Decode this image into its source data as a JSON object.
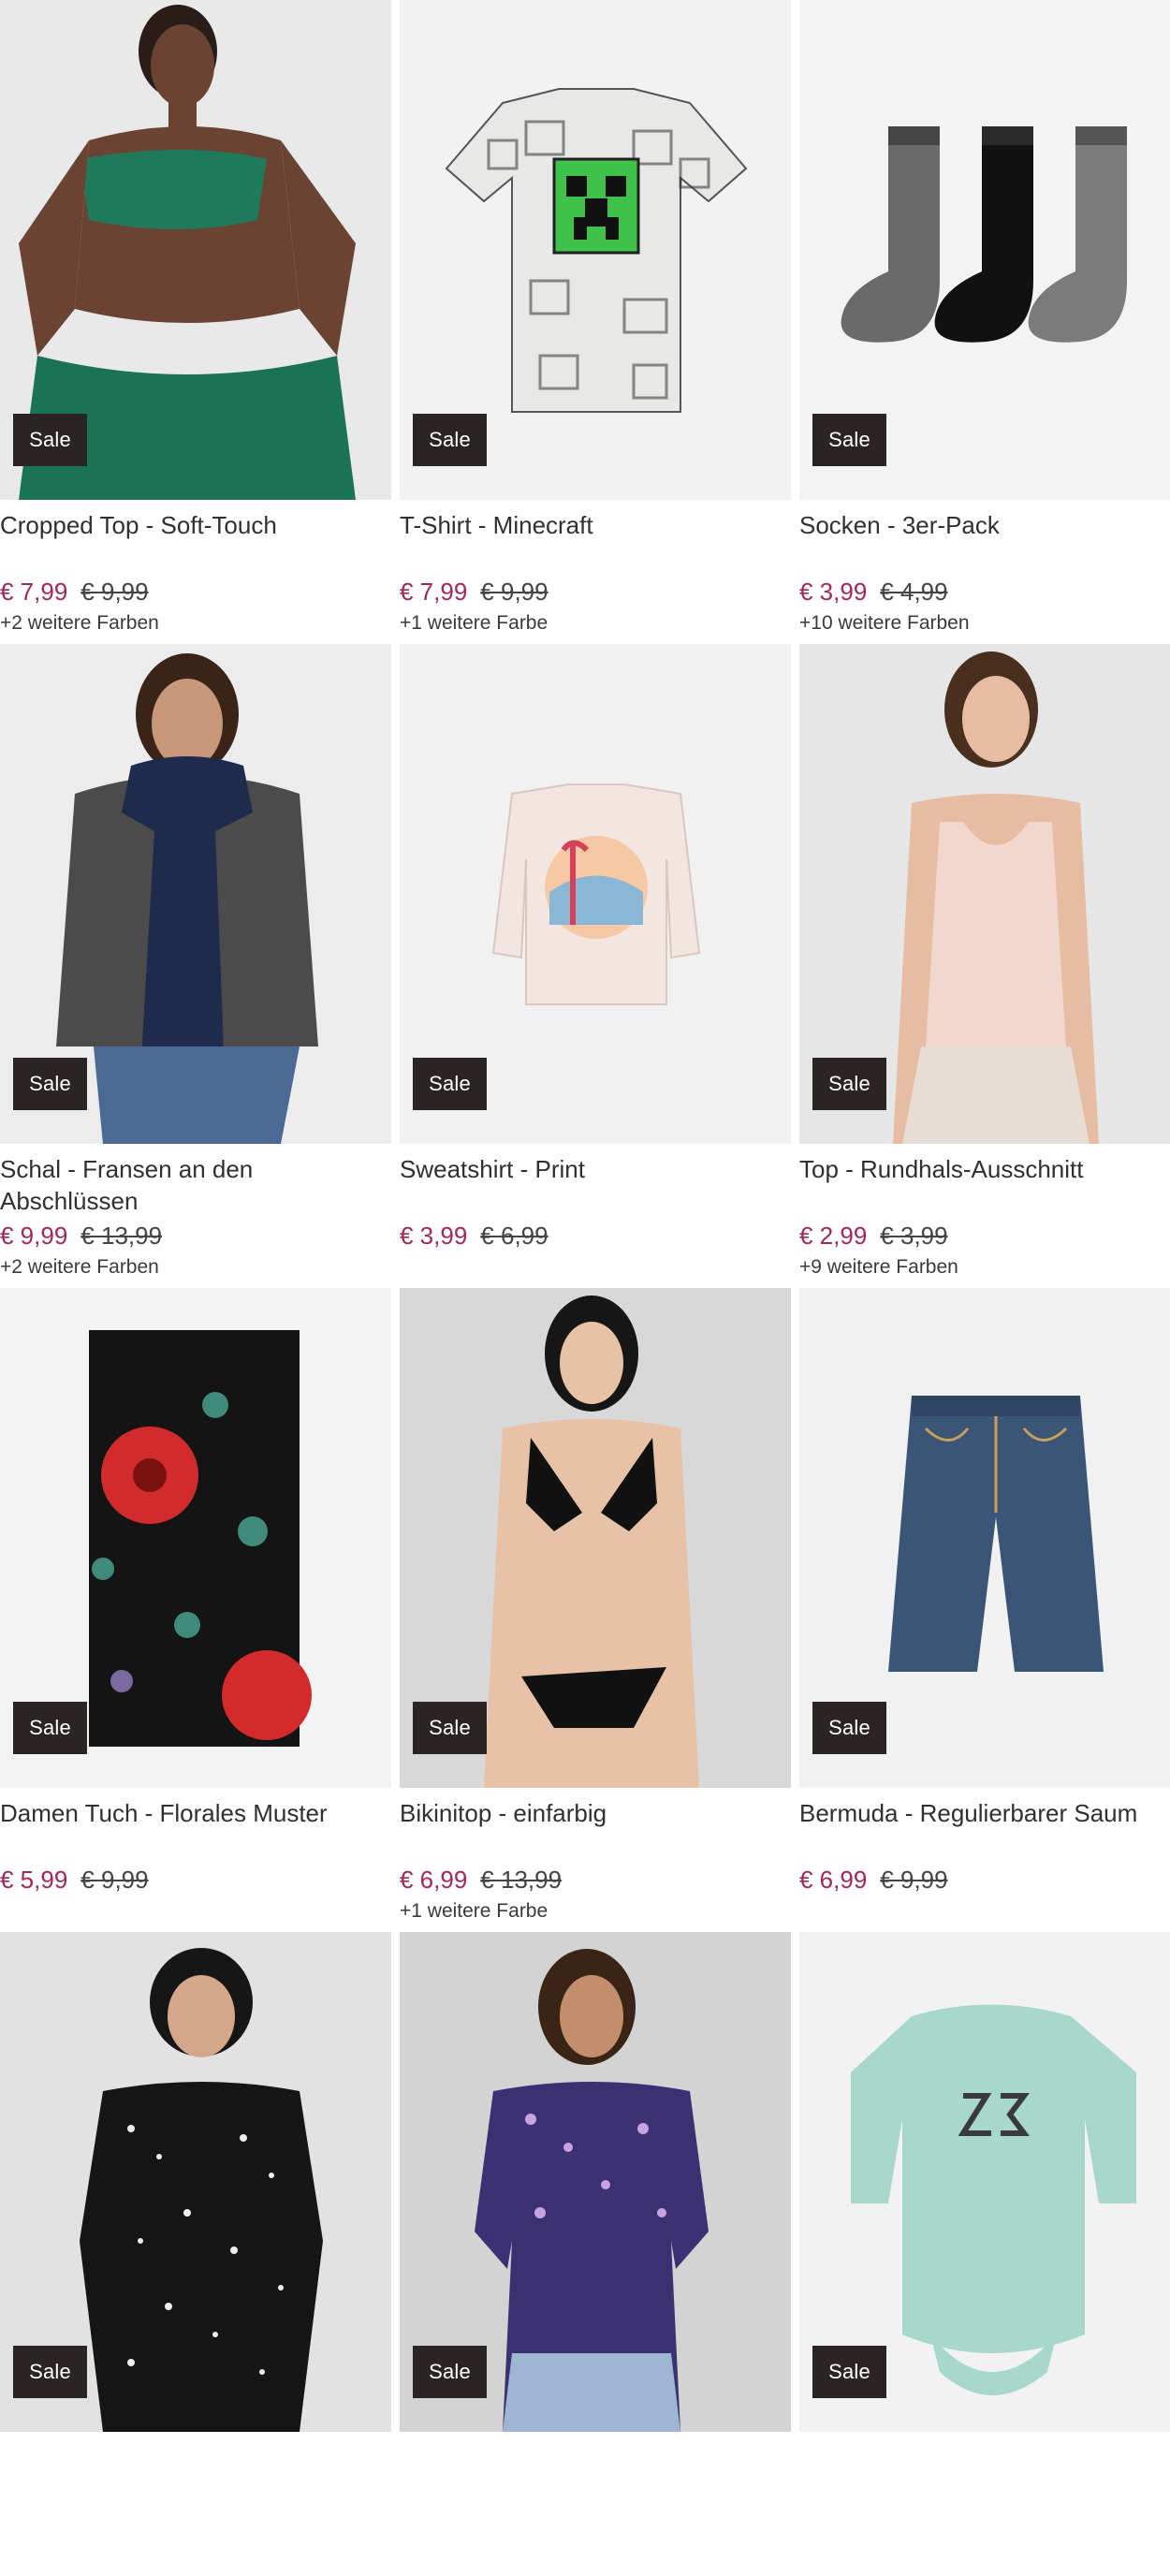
{
  "products": [
    {
      "name": "Cropped Top - Soft-Touch",
      "badge": "Sale",
      "price": "€ 7,99",
      "old_price": "€ 9,99",
      "colors": "+2 weitere Farben",
      "image": "cropped-top-photo"
    },
    {
      "name": "T-Shirt - Minecraft",
      "badge": "Sale",
      "price": "€ 7,99",
      "old_price": "€ 9,99",
      "colors": "+1 weitere Farbe",
      "image": "tshirt-minecraft-photo"
    },
    {
      "name": "Socken - 3er-Pack",
      "badge": "Sale",
      "price": "€ 3,99",
      "old_price": "€ 4,99",
      "colors": "+10 weitere Farben",
      "image": "socks-photo"
    },
    {
      "name": "Schal - Fransen an den Abschlüssen",
      "badge": "Sale",
      "price": "€ 9,99",
      "old_price": "€ 13,99",
      "colors": "+2 weitere Farben",
      "image": "scarf-photo"
    },
    {
      "name": "Sweatshirt - Print",
      "badge": "Sale",
      "price": "€ 3,99",
      "old_price": "€ 6,99",
      "colors": "",
      "image": "sweatshirt-photo"
    },
    {
      "name": "Top - Rundhals-Ausschnitt",
      "badge": "Sale",
      "price": "€ 2,99",
      "old_price": "€ 3,99",
      "colors": "+9 weitere Farben",
      "image": "tank-top-photo"
    },
    {
      "name": "Damen Tuch - Florales Muster",
      "badge": "Sale",
      "price": "€ 5,99",
      "old_price": "€ 9,99",
      "colors": "",
      "image": "floral-scarf-photo"
    },
    {
      "name": "Bikinitop - einfarbig",
      "badge": "Sale",
      "price": "€ 6,99",
      "old_price": "€ 13,99",
      "colors": "+1 weitere Farbe",
      "image": "bikini-photo"
    },
    {
      "name": "Bermuda - Regulierbarer Saum",
      "badge": "Sale",
      "price": "€ 6,99",
      "old_price": "€ 9,99",
      "colors": "",
      "image": "bermuda-photo"
    },
    {
      "name": "",
      "badge": "Sale",
      "price": "",
      "old_price": "",
      "colors": "",
      "image": "blouse-black-photo"
    },
    {
      "name": "",
      "badge": "Sale",
      "price": "",
      "old_price": "",
      "colors": "",
      "image": "blouse-floral-photo"
    },
    {
      "name": "",
      "badge": "Sale",
      "price": "",
      "old_price": "",
      "colors": "",
      "image": "baby-body-photo"
    }
  ],
  "colors": {
    "sale_badge_bg": "#2a2422",
    "price_sale": "#a6265a",
    "text": "#303030",
    "image_bg": "#f0f0f0"
  }
}
